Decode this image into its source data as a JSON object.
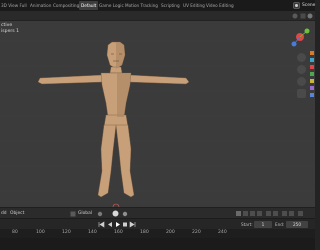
{
  "workspace_tabs": [
    {
      "label": "3D View Full",
      "active": false
    },
    {
      "label": "Animation",
      "active": false
    },
    {
      "label": "Compositing",
      "active": false
    },
    {
      "label": "Default",
      "active": true
    },
    {
      "label": "Game Logic",
      "active": false
    },
    {
      "label": "Motion Tracking",
      "active": false
    },
    {
      "label": "Scripting",
      "active": false
    },
    {
      "label": "UV Editing",
      "active": false
    },
    {
      "label": "Video Editing",
      "active": false
    }
  ],
  "scene_label": "Scene",
  "viewport": {
    "view_label": "ctive",
    "sub_label": "ispers 1"
  },
  "footer": {
    "menu_label": "dd",
    "mode_label": "Object",
    "orientation": "Global"
  },
  "timeline": {
    "start_label": "Start:",
    "start_value": "1",
    "end_label": "End:",
    "end_value": "250"
  },
  "ruler_ticks": [
    "80",
    "100",
    "120",
    "140",
    "160",
    "180",
    "200",
    "220",
    "240"
  ],
  "colors": {
    "viewport_bg": "#3b3b3b",
    "skin": "#c79f78",
    "skin_shadow": "#a98562",
    "active_tab": "#3d3d3d",
    "axis_red": "#e04646",
    "axis_green": "#6fbe3c",
    "axis_blue": "#4a7bd9"
  },
  "icons": [
    "scene-icon",
    "navigation-gizmo",
    "zoom-icon",
    "pan-icon",
    "camera-icon",
    "grid-icon",
    "play-icon",
    "stop-icon",
    "skip-start-icon",
    "skip-end-icon",
    "magnet-icon",
    "proportional-icon"
  ]
}
